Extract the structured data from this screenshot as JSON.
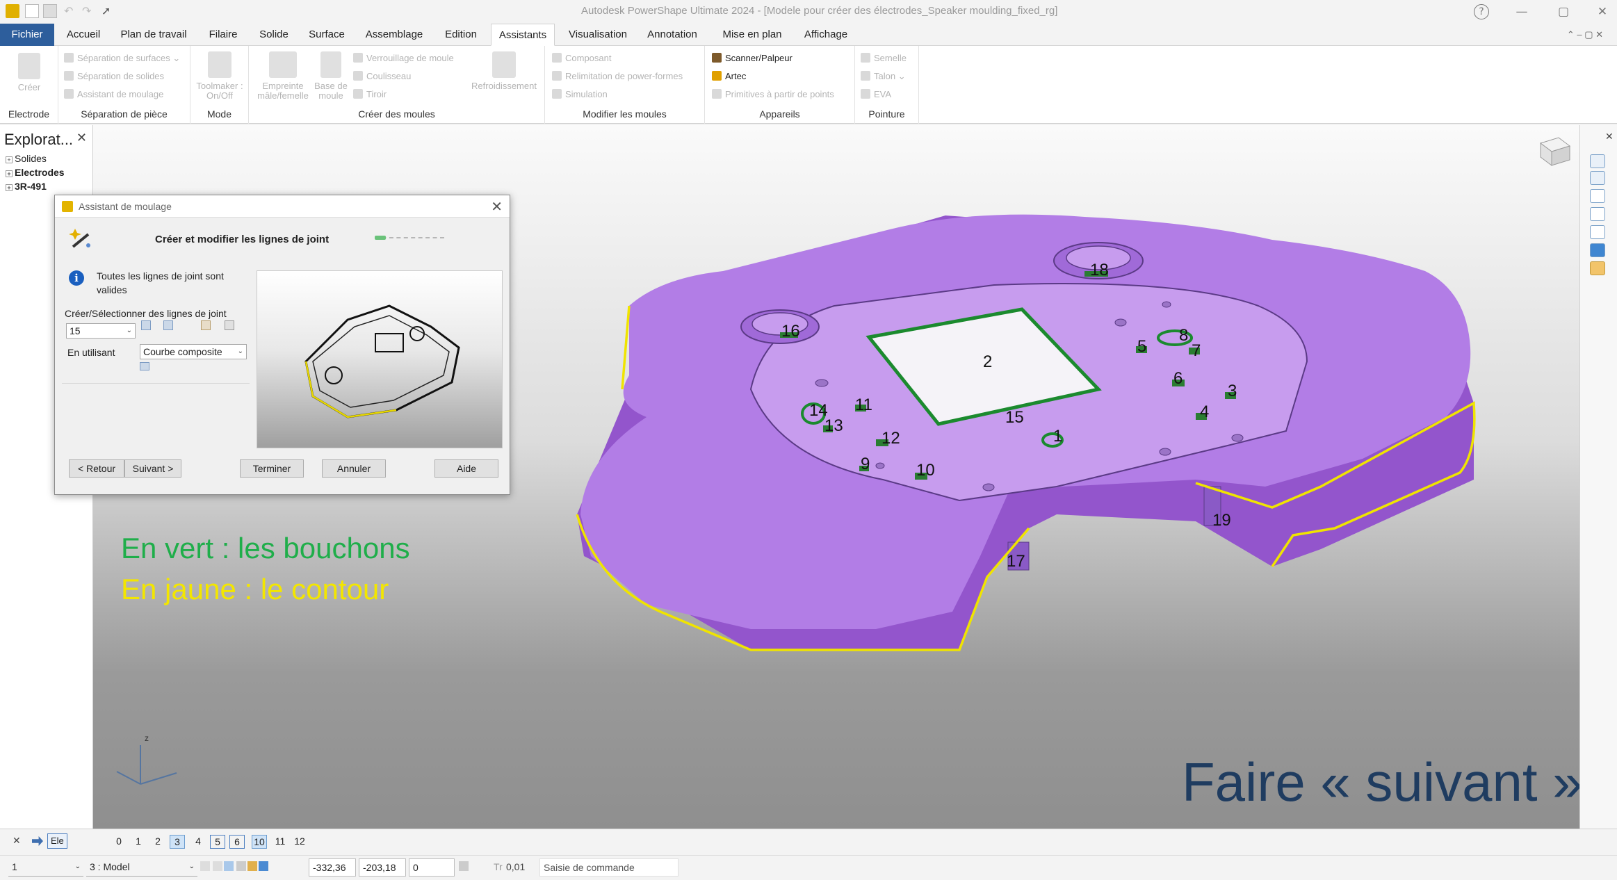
{
  "window": {
    "title": "Autodesk PowerShape Ultimate 2024 - [Modele pour créer des électrodes_Speaker moulding_fixed_rg]",
    "help_symbol": "?"
  },
  "tabs": [
    {
      "label": "Fichier"
    },
    {
      "label": "Accueil"
    },
    {
      "label": "Plan de travail"
    },
    {
      "label": "Filaire"
    },
    {
      "label": "Solide"
    },
    {
      "label": "Surface"
    },
    {
      "label": "Assemblage"
    },
    {
      "label": "Edition"
    },
    {
      "label": "Assistants"
    },
    {
      "label": "Visualisation"
    },
    {
      "label": "Annotation"
    },
    {
      "label": "Mise en plan"
    },
    {
      "label": "Affichage"
    }
  ],
  "ribbon": {
    "electrode": {
      "create": "Créer",
      "group": "Electrode"
    },
    "separation": {
      "items": [
        "Séparation de surfaces",
        "Séparation de solides",
        "Assistant de moulage"
      ],
      "group": "Séparation de pièce"
    },
    "mode": {
      "toolmaker": "Toolmaker : On/Off",
      "group": "Mode"
    },
    "moules": {
      "empreinte": "Empreinte mâle/femelle",
      "base": "Base de moule",
      "items": [
        "Verrouillage de moule",
        "Coulisseau",
        "Tiroir"
      ],
      "refroidissement": "Refroidissement",
      "group": "Créer des moules"
    },
    "modifier": {
      "items": [
        "Composant",
        "Relimitation de power-formes",
        "Simulation"
      ],
      "group": "Modifier les moules"
    },
    "appareils": {
      "items": [
        "Scanner/Palpeur",
        "Artec",
        "Primitives à partir de points"
      ],
      "group": "Appareils"
    },
    "pointure": {
      "items": [
        "Semelle",
        "Talon",
        "EVA"
      ],
      "group": "Pointure"
    }
  },
  "explorer": {
    "title": "Explorat...",
    "items": [
      "Solides",
      "Electrodes",
      "3R-491"
    ]
  },
  "dialog": {
    "title": "Assistant de moulage",
    "heading": "Créer et modifier les lignes de joint",
    "info": "Toutes les lignes de joint sont valides",
    "select_label": "Créer/Sélectionner des lignes de joint",
    "select_value": "15",
    "using_label": "En utilisant",
    "using_value": "Courbe composite",
    "buttons": {
      "back": "< Retour",
      "next": "Suivant >",
      "finish": "Terminer",
      "cancel": "Annuler",
      "help": "Aide"
    }
  },
  "model_labels": [
    "1",
    "2",
    "3",
    "4",
    "5",
    "6",
    "7",
    "8",
    "9",
    "10",
    "11",
    "12",
    "13",
    "14",
    "15",
    "16",
    "17",
    "18",
    "19"
  ],
  "annotations": {
    "green": "En vert : les bouchons",
    "yellow": "En jaune : le contour",
    "blue": "Faire « suivant »"
  },
  "axis": {
    "z": "z"
  },
  "levels": [
    "0",
    "1",
    "2",
    "3",
    "4",
    "5",
    "6",
    "10",
    "11",
    "12"
  ],
  "levels_active": [
    "3",
    "10"
  ],
  "levels_boxed": [
    "5",
    "6"
  ],
  "statusbar": {
    "workspace_label": "Ele",
    "field1": "1",
    "model": "3  : Model",
    "x": "-332,36",
    "y": "-203,18",
    "z": "0",
    "tol_prefix": "Tr",
    "tolerance": "0,01",
    "command_placeholder": "Saisie de commande"
  },
  "colors": {
    "model_purple": "#b27de6",
    "plug_green": "#1b8a2e",
    "contour_yellow": "#f0e400",
    "file_tab_blue": "#2d5e9c",
    "note_blue": "#1f3c60"
  }
}
